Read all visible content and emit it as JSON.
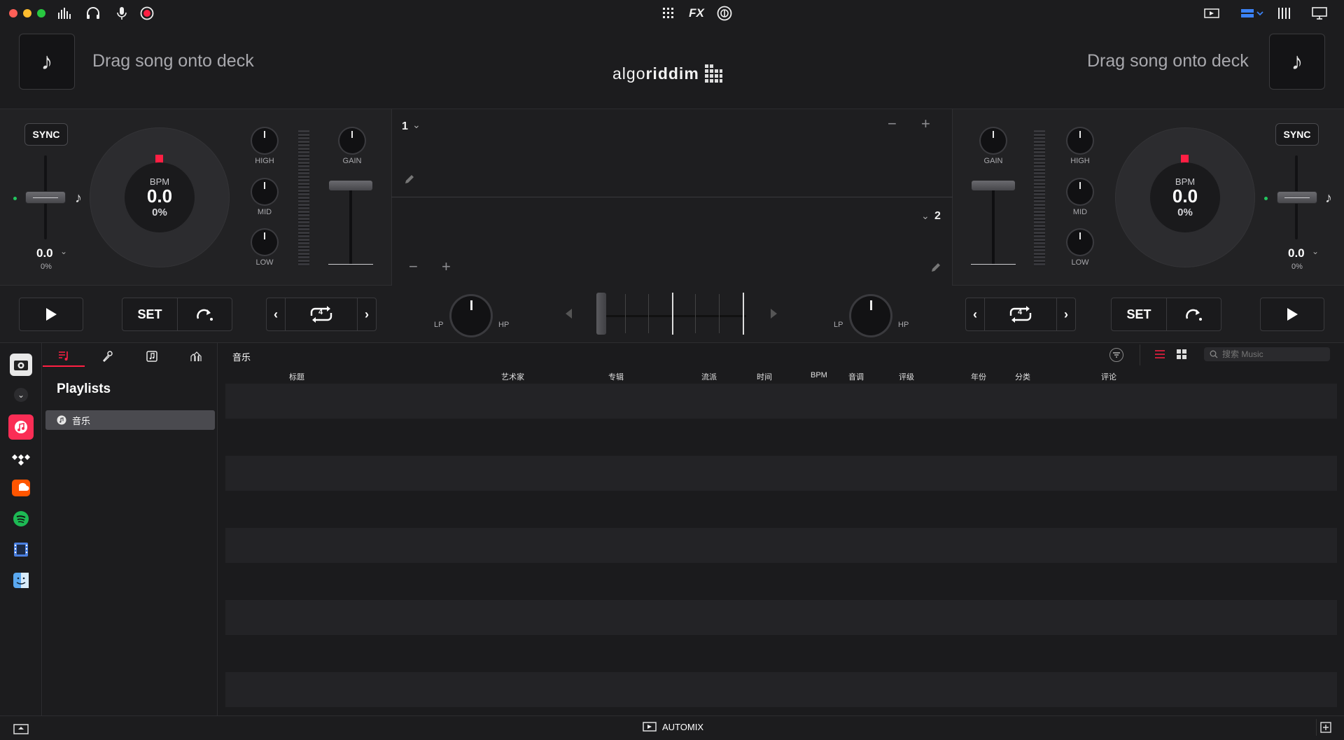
{
  "header": {
    "left_drop_text": "Drag song onto deck",
    "right_drop_text": "Drag song onto deck",
    "logo_light": "algo",
    "logo_bold": "riddim"
  },
  "titlebar": {
    "fx_label": "FX"
  },
  "deck_left": {
    "sync_label": "SYNC",
    "bpm_label": "BPM",
    "bpm_value": "0.0",
    "bpm_pct": "0%",
    "pitch_value": "0.0",
    "pitch_pct": "0%",
    "eq_high": "HIGH",
    "eq_mid": "MID",
    "eq_low": "LOW",
    "gain_label": "GAIN"
  },
  "deck_right": {
    "sync_label": "SYNC",
    "bpm_label": "BPM",
    "bpm_value": "0.0",
    "bpm_pct": "0%",
    "pitch_value": "0.0",
    "pitch_pct": "0%",
    "eq_high": "HIGH",
    "eq_mid": "MID",
    "eq_low": "LOW",
    "gain_label": "GAIN"
  },
  "waveform": {
    "deck1_label": "1",
    "deck2_label": "2",
    "minus": "−",
    "plus": "+"
  },
  "transport": {
    "set_label": "SET",
    "loop_count": "4",
    "lp_label": "LP",
    "hp_label": "HP"
  },
  "library": {
    "playlists_title": "Playlists",
    "playlist_item": "音乐",
    "list_title": "音乐",
    "search_placeholder": "搜索 Music",
    "columns": [
      "标题",
      "艺术家",
      "专辑",
      "流派",
      "时间",
      "BPM",
      "音调",
      "评级",
      "年份",
      "分类",
      "评论"
    ]
  },
  "bottombar": {
    "automix_label": "AUTOMIX"
  },
  "colors": {
    "accent": "#ff1f43",
    "background": "#1b1b1d",
    "panel": "#222224"
  }
}
